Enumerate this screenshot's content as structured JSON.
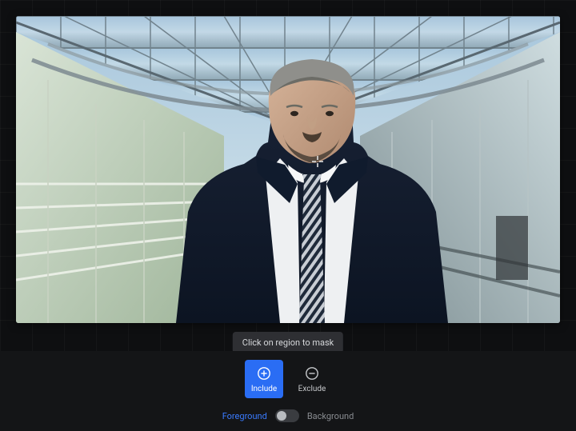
{
  "tooltip": {
    "text": "Click on region to mask"
  },
  "modes": {
    "include": {
      "label": "Include",
      "active": true
    },
    "exclude": {
      "label": "Exclude",
      "active": false
    }
  },
  "layer_toggle": {
    "foreground_label": "Foreground",
    "background_label": "Background",
    "value": "foreground"
  },
  "colors": {
    "accent": "#2a6df4",
    "accent_text": "#3a7bff"
  }
}
